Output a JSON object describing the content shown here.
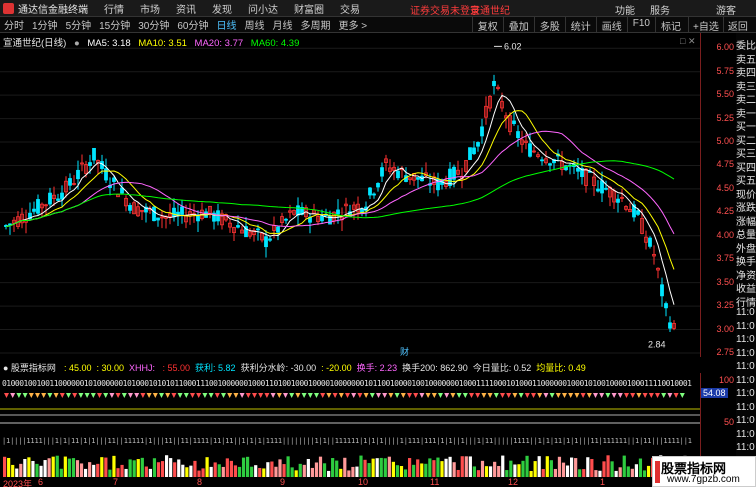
{
  "titlebar": {
    "app_title": "通达信金融终端",
    "menu": [
      "行情",
      "市场",
      "资讯",
      "发现",
      "问小达",
      "财富圈",
      "交易"
    ],
    "notice": "证券交易未登录",
    "stock_link": "宣通世纪",
    "right_items": [
      "功能",
      "服务",
      "游客"
    ]
  },
  "periods": [
    {
      "label": "分时",
      "active": false
    },
    {
      "label": "1分钟",
      "active": false
    },
    {
      "label": "5分钟",
      "active": false
    },
    {
      "label": "15分钟",
      "active": false
    },
    {
      "label": "30分钟",
      "active": false
    },
    {
      "label": "60分钟",
      "active": false
    },
    {
      "label": "日线",
      "active": true
    },
    {
      "label": "周线",
      "active": false
    },
    {
      "label": "月线",
      "active": false
    },
    {
      "label": "多周期",
      "active": false
    },
    {
      "label": "更多 >",
      "active": false
    }
  ],
  "toolbar": [
    "复权",
    "叠加",
    "多股",
    "统计",
    "画线",
    "F10",
    "标记",
    "+自选"
  ],
  "right_tab": "返回",
  "chart": {
    "stock_name": "宣通世纪(日线)",
    "ma": [
      {
        "label": "MA5: 3.18",
        "color": "#ffffff"
      },
      {
        "label": "MA10: 3.51",
        "color": "#ffff00"
      },
      {
        "label": "MA20: 3.77",
        "color": "#ff66ff"
      },
      {
        "label": "MA60: 4.39",
        "color": "#00ff00"
      }
    ],
    "high_label": "6.02",
    "low_label": "2.84",
    "colors": {
      "up": "#ff3232",
      "down": "#00e5ff"
    }
  },
  "chart_data": {
    "type": "candlestick",
    "y_ticks": [
      "6.00",
      "5.75",
      "5.50",
      "5.25",
      "5.00",
      "4.75",
      "4.50",
      "4.25",
      "4.00",
      "3.75",
      "3.50",
      "3.25",
      "3.00",
      "2.75"
    ],
    "ylim": [
      2.75,
      6.12
    ],
    "high": 6.02,
    "low": 2.84
  },
  "orderbook": [
    "委比",
    "卖五",
    "卖四",
    "卖三",
    "卖二",
    "卖一",
    "买一",
    "买二",
    "买三",
    "买四",
    "买五",
    "现价",
    "涨跌",
    "涨幅",
    "总量",
    "外盘",
    "换手",
    "净资",
    "收益",
    "行情",
    "11:0",
    "11:0",
    "11:0",
    "11:0",
    "11:0",
    "11:0",
    "11:0",
    "11:0",
    "11:0",
    "11:0",
    "11:0",
    "11:0",
    "11:0"
  ],
  "subchart": {
    "name": "股票指标网",
    "items": [
      {
        "label": ": 45.00",
        "color": "#ffff00"
      },
      {
        "label": ": 30.00",
        "color": "#ffff00"
      },
      {
        "label": "XHHJ: ",
        "color": "#ff66ff"
      },
      {
        "label": ": 55.00",
        "color": "#ff3232"
      },
      {
        "label": "获利: 5.82",
        "color": "#00e5ff"
      },
      {
        "label": "获利分水岭: -30.00",
        "color": "#e6e6e6"
      },
      {
        "label": ": -20.00",
        "color": "#ffff00"
      },
      {
        "label": "换手: 2.23",
        "color": "#ff66ff"
      },
      {
        "label": "换手200: 862.90",
        "color": "#e6e6e6"
      },
      {
        "label": "今日量比: 0.52",
        "color": "#e6e6e6"
      },
      {
        "label": "均量比: 0.49",
        "color": "#ffff00"
      }
    ],
    "badge": "54.08",
    "ticks": [
      "100",
      "50"
    ]
  },
  "time_axis": [
    "2023年",
    "6",
    "7",
    "8",
    "9",
    "10",
    "11",
    "12",
    "1"
  ],
  "marker_label": "财",
  "watermark": {
    "name": "股票指标网",
    "url": "www.7gpzb.com"
  }
}
